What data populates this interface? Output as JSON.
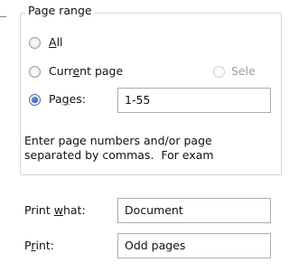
{
  "page_range": {
    "legend": "Page range",
    "options": {
      "all": {
        "pre": "",
        "key": "A",
        "post": "ll",
        "selected": false,
        "enabled": true
      },
      "current_page": {
        "pre": "Curr",
        "key": "e",
        "post": "nt page",
        "selected": false,
        "enabled": true
      },
      "selection": {
        "label": "Sele",
        "selected": false,
        "enabled": false
      },
      "pages": {
        "pre": "Pa",
        "key": "g",
        "post": "es:",
        "selected": true,
        "enabled": true
      }
    },
    "pages_value": "1-55",
    "help_line1": "Enter page numbers and/or page",
    "help_line2": "separated by commas.  For exam"
  },
  "print_what": {
    "pre": "Print ",
    "key": "w",
    "post": "hat:",
    "value": "Document"
  },
  "print": {
    "pre": "P",
    "key": "r",
    "post": "int:",
    "value": "Odd pages"
  }
}
